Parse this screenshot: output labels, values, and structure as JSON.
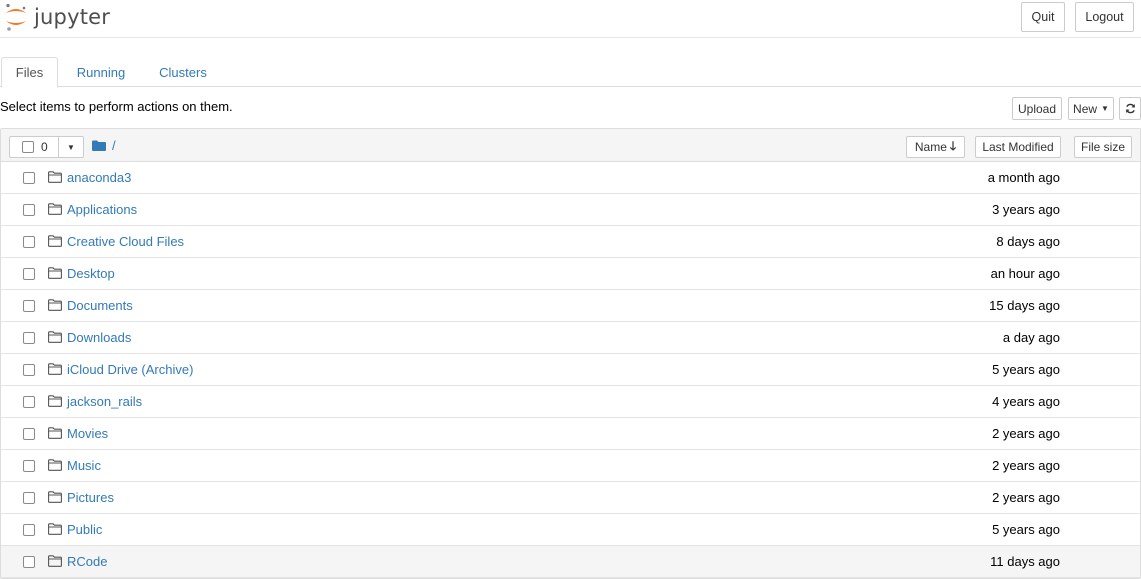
{
  "header": {
    "logo_text": "jupyter",
    "quit_label": "Quit",
    "logout_label": "Logout"
  },
  "tabs": [
    {
      "label": "Files"
    },
    {
      "label": "Running"
    },
    {
      "label": "Clusters"
    }
  ],
  "toolbar": {
    "hint": "Select items to perform actions on them.",
    "upload_label": "Upload",
    "new_label": "New",
    "refresh_icon": "refresh-icon"
  },
  "list_header": {
    "selected_count": "0",
    "breadcrumb": "/",
    "sort_name_label": "Name",
    "sort_modified_label": "Last Modified",
    "sort_size_label": "File size"
  },
  "items": [
    {
      "name": "anaconda3",
      "modified": "a month ago"
    },
    {
      "name": "Applications",
      "modified": "3 years ago"
    },
    {
      "name": "Creative Cloud Files",
      "modified": "8 days ago"
    },
    {
      "name": "Desktop",
      "modified": "an hour ago"
    },
    {
      "name": "Documents",
      "modified": "15 days ago"
    },
    {
      "name": "Downloads",
      "modified": "a day ago"
    },
    {
      "name": "iCloud Drive (Archive)",
      "modified": "5 years ago"
    },
    {
      "name": "jackson_rails",
      "modified": "4 years ago"
    },
    {
      "name": "Movies",
      "modified": "2 years ago"
    },
    {
      "name": "Music",
      "modified": "2 years ago"
    },
    {
      "name": "Pictures",
      "modified": "2 years ago"
    },
    {
      "name": "Public",
      "modified": "5 years ago"
    },
    {
      "name": "RCode",
      "modified": "11 days ago"
    }
  ],
  "colors": {
    "link": "#337ab7",
    "logo_orange": "#f37726",
    "header_bg": "#f5f5f5"
  }
}
